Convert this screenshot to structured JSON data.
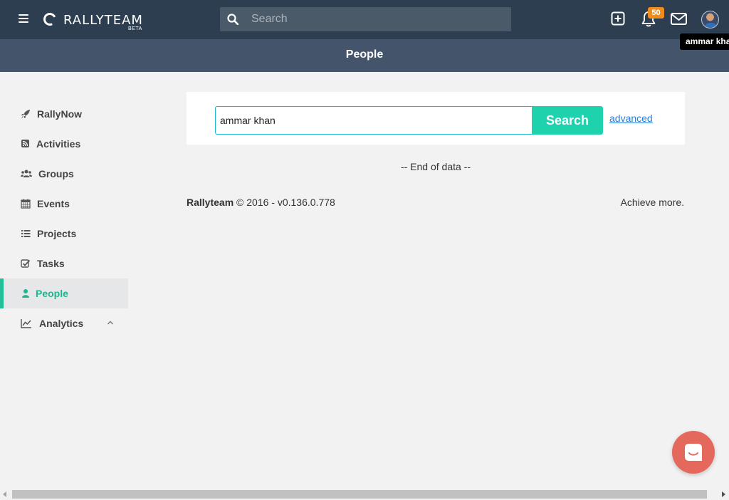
{
  "app": {
    "logo_text": "RALLYTEAM",
    "logo_badge": "BETA"
  },
  "topbar": {
    "search_placeholder": "Search",
    "notification_count": "50",
    "user_tooltip": "ammar khan"
  },
  "page": {
    "title": "People"
  },
  "sidebar": {
    "items": [
      {
        "label": "RallyNow",
        "icon": "rocket-icon"
      },
      {
        "label": "Activities",
        "icon": "rss-icon"
      },
      {
        "label": "Groups",
        "icon": "users-icon"
      },
      {
        "label": "Events",
        "icon": "calendar-icon"
      },
      {
        "label": "Projects",
        "icon": "list-icon"
      },
      {
        "label": "Tasks",
        "icon": "checkbox-icon"
      },
      {
        "label": "People",
        "icon": "user-icon",
        "active": true
      },
      {
        "label": "Analytics",
        "icon": "line-chart-icon",
        "expandable": true
      }
    ]
  },
  "people_search": {
    "query": "ammar khan",
    "button_label": "Search",
    "advanced_link": "advanced"
  },
  "results": {
    "end_text": "-- End of data --"
  },
  "footer": {
    "brand": "Rallyteam",
    "copyright": "© 2016 - v0.136.0.778",
    "tagline": "Achieve more."
  },
  "colors": {
    "topbar": "#2d3e50",
    "subheader": "#44546a",
    "accent": "#1ed2ae",
    "badge": "#f08c1c",
    "chat": "#e5685c"
  }
}
